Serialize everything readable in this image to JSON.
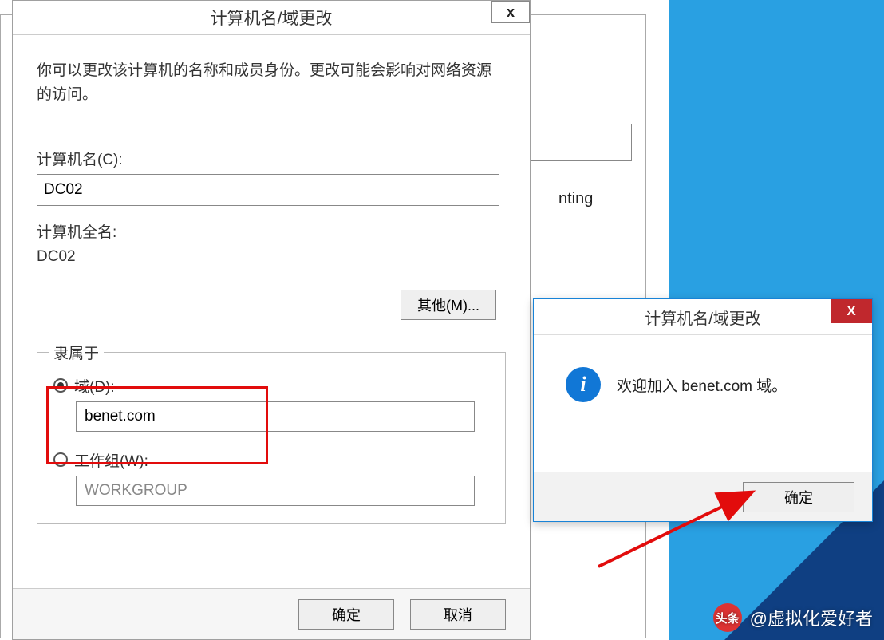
{
  "background": {
    "text_fragment": "nting"
  },
  "dialog": {
    "title": "计算机名/域更改",
    "close_glyph": "x",
    "description": "你可以更改该计算机的名称和成员身份。更改可能会影响对网络资源的访问。",
    "computer_name_label": "计算机名(C):",
    "computer_name_value": "DC02",
    "full_name_label": "计算机全名:",
    "full_name_value": "DC02",
    "more_button": "其他(M)...",
    "group_legend": "隶属于",
    "domain_radio_label": "域(D):",
    "domain_value": "benet.com",
    "workgroup_radio_label": "工作组(W):",
    "workgroup_value": "WORKGROUP",
    "ok_button": "确定",
    "cancel_button": "取消"
  },
  "msgbox": {
    "title": "计算机名/域更改",
    "close_glyph": "X",
    "info_glyph": "i",
    "message": "欢迎加入 benet.com 域。",
    "ok_button": "确定"
  },
  "watermark": {
    "logo_text": "头条",
    "author": "@虚拟化爱好者"
  }
}
